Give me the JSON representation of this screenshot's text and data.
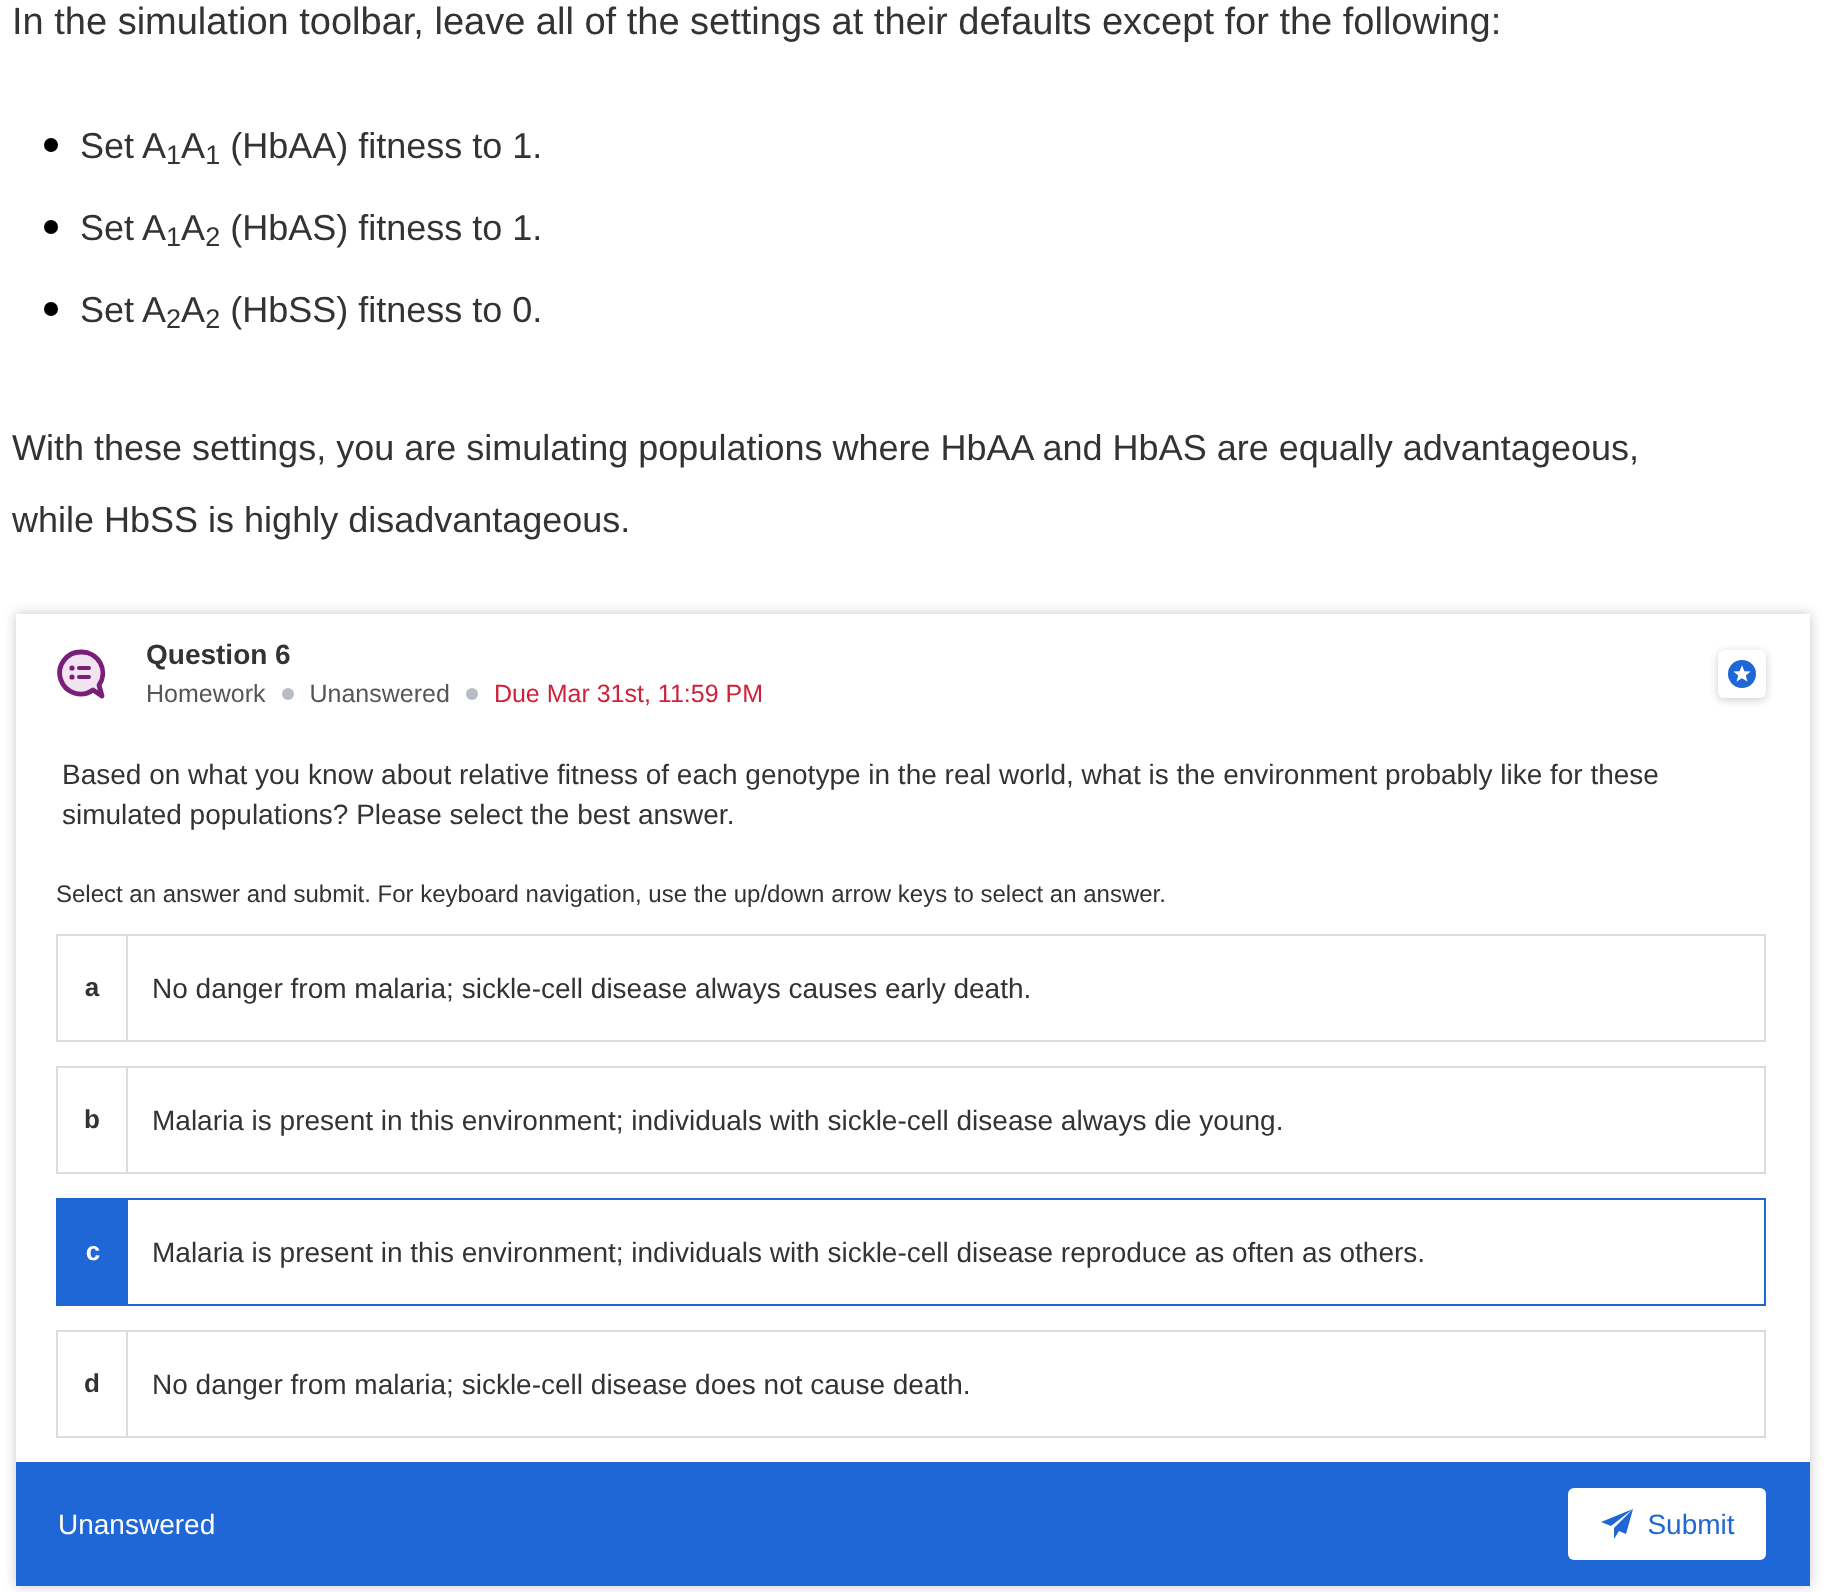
{
  "instructions": {
    "intro": "In the simulation toolbar, leave all of the settings at their defaults except for the following:",
    "bullets": [
      "Set A$_{1}$A$_{1}$ (HbAA) fitness to 1.",
      "Set A$_{1}$A$_{2}$ (HbAS) fitness to 1.",
      "Set A$_{2}$A$_{2}$ (HbSS) fitness to 0."
    ]
  },
  "summary": "With these settings, you are simulating populations where HbAA and HbAS are equally advantageous, while HbSS is highly disadvantageous.",
  "question": {
    "title": "Question 6",
    "meta": [
      {
        "text": "Homework",
        "kind": "plain"
      },
      {
        "text": "Unanswered",
        "kind": "plain"
      },
      {
        "text": "Due Mar 31st, 11:59 PM",
        "kind": "due"
      }
    ],
    "prompt": "Based on what you know about relative fitness of each genotype in the real world, what is the environment probably like for these simulated populations? Please select the best answer.",
    "instruction": "Select an answer and submit. For keyboard navigation, use the up/down arrow keys to select an answer.",
    "choices": [
      {
        "letter": "a",
        "text": "No danger from malaria; sickle-cell disease always causes early death.",
        "selected": false
      },
      {
        "letter": "b",
        "text": "Malaria is present in this environment; individuals with sickle-cell disease always die young.",
        "selected": false
      },
      {
        "letter": "c",
        "text": "Malaria is present in this environment; individuals with sickle-cell disease reproduce as often as others.",
        "selected": true
      },
      {
        "letter": "d",
        "text": "No danger from malaria; sickle-cell disease does not cause death.",
        "selected": false
      }
    ]
  },
  "footer": {
    "status": "Unanswered",
    "submit": "Submit"
  }
}
